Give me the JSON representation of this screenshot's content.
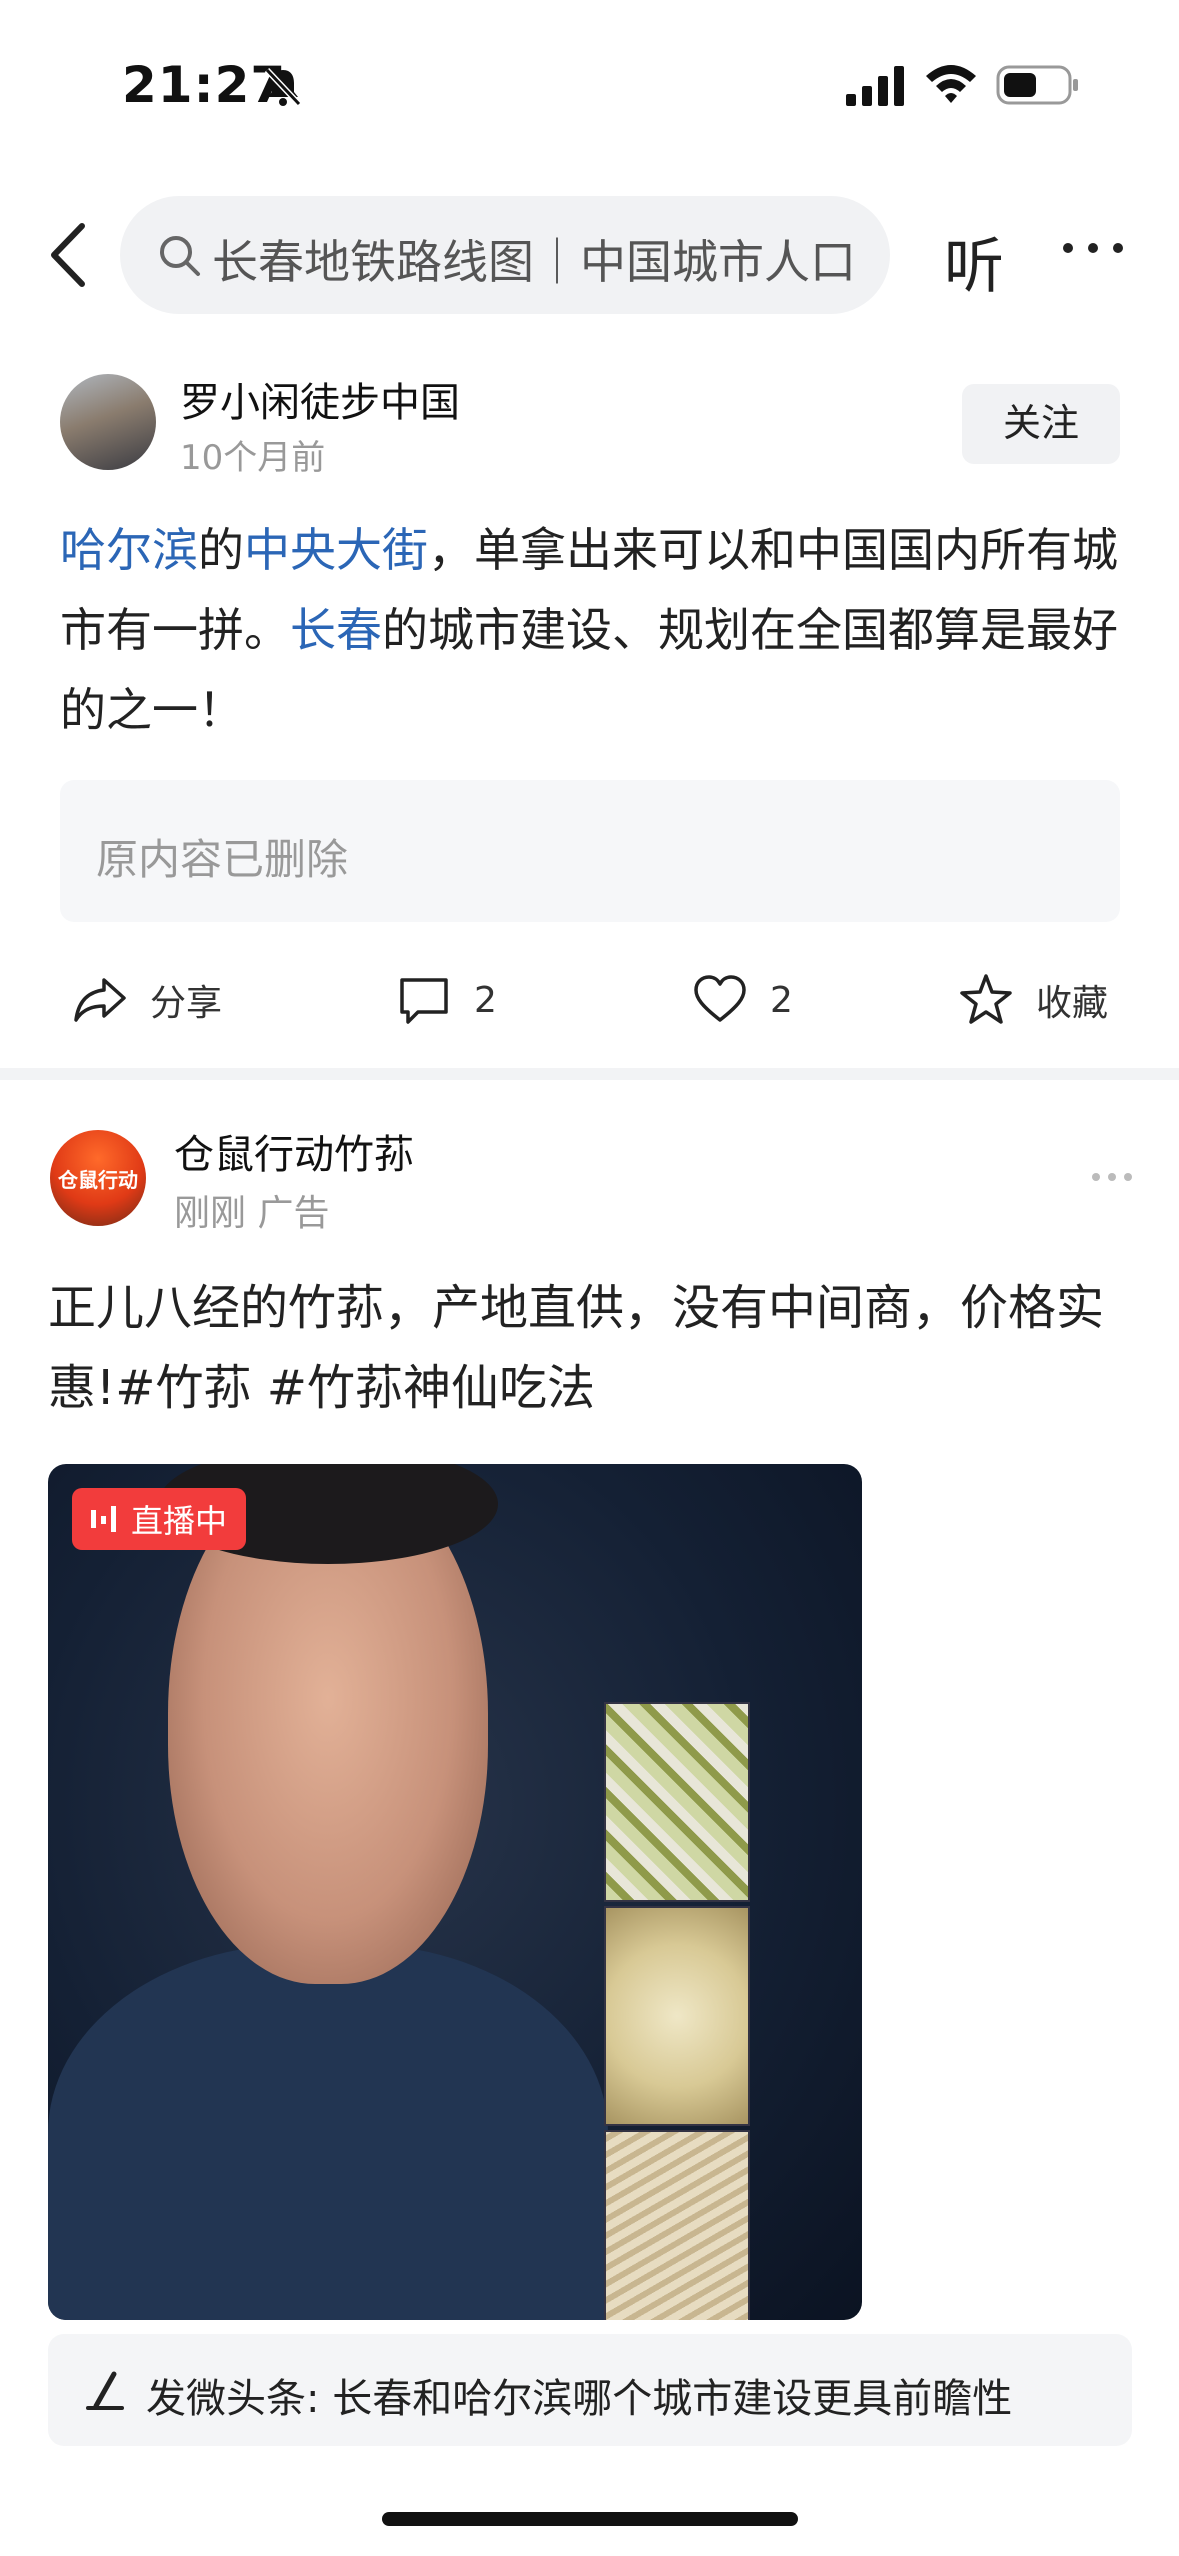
{
  "status_bar": {
    "time": "21:27",
    "icons": [
      "bell-slash-icon",
      "signal-icon",
      "wifi-icon",
      "battery-icon"
    ]
  },
  "nav": {
    "back_icon": "chevron-left-icon",
    "search_text": "长春地铁路线图｜中国城市人口",
    "listen_label": "听",
    "more_icon": "more-dots-icon"
  },
  "post1": {
    "author": "罗小闲徒步中国",
    "time": "10个月前",
    "follow_label": "关注",
    "text": {
      "link1": "哈尔滨",
      "part1": "的",
      "link2": "中央大街",
      "part2": "，单拿出来可以和中国国内所有城市有一拼。",
      "link3": "长春",
      "part3": "的城市建设、规划在全国都算是最好的之一！"
    },
    "deleted_notice": "原内容已删除",
    "actions": {
      "share": "分享",
      "comments": "2",
      "likes": "2",
      "favorite": "收藏"
    }
  },
  "post2": {
    "author": "仓鼠行动竹荪",
    "avatar_text": "仓鼠行动",
    "time": "刚刚 广告",
    "text": "正儿八经的竹荪，产地直供，没有中间商，价格实惠!#竹荪 #竹荪神仙吃法",
    "live_badge": "直播中"
  },
  "bottom_bar": {
    "text": "发微头条: 长春和哈尔滨哪个城市建设更具前瞻性"
  },
  "colors": {
    "link": "#2b66b6",
    "live_badge": "#f23c3c",
    "search_bg": "#f1f2f4"
  }
}
